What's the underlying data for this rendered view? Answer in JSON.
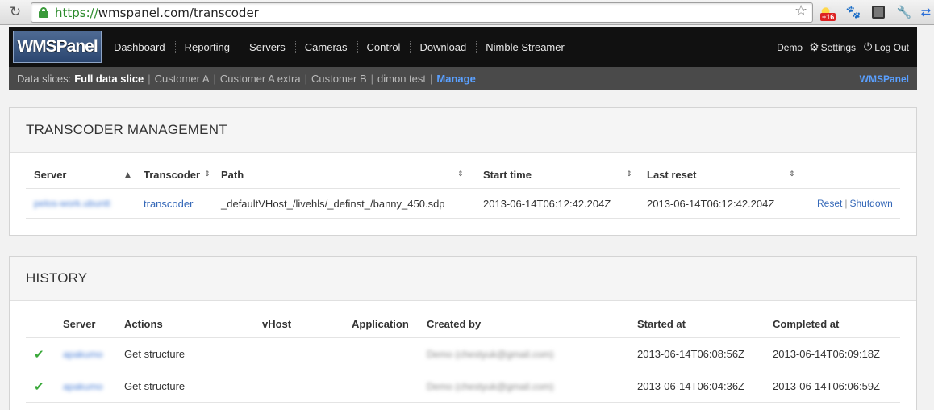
{
  "browser": {
    "url_scheme": "https://",
    "url_rest": "wmspanel.com/transcoder",
    "weather_badge": "+16"
  },
  "header": {
    "logo": "WMSPanel",
    "nav": [
      "Dashboard",
      "Reporting",
      "Servers",
      "Cameras",
      "Control",
      "Download",
      "Nimble Streamer"
    ],
    "user": "Demo",
    "settings": "Settings",
    "logout": "Log Out"
  },
  "slices": {
    "label": "Data slices:",
    "active": "Full data slice",
    "items": [
      "Customer A",
      "Customer A extra",
      "Customer B",
      "dimon test"
    ],
    "manage": "Manage",
    "brand": "WMSPanel"
  },
  "transcoder": {
    "title": "TRANSCODER MANAGEMENT",
    "columns": [
      "Server",
      "Transcoder",
      "Path",
      "Start time",
      "Last reset"
    ],
    "rows": [
      {
        "server": "pelos-work.ubuntt",
        "transcoder": "transcoder",
        "path": "_defaultVHost_/livehls/_definst_/banny_450.sdp",
        "start_time": "2013-06-14T06:12:42.204Z",
        "last_reset": "2013-06-14T06:12:42.204Z",
        "reset": "Reset",
        "shutdown": "Shutdown"
      }
    ]
  },
  "history": {
    "title": "HISTORY",
    "columns": [
      "Server",
      "Actions",
      "vHost",
      "Application",
      "Created by",
      "Started at",
      "Completed at"
    ],
    "rows": [
      {
        "server": "apakumo",
        "action": "Get structure",
        "vhost": "",
        "application": "",
        "created_by": "Demo (chestyuk@gmail.com)",
        "started_at": "2013-06-14T06:08:56Z",
        "completed_at": "2013-06-14T06:09:18Z"
      },
      {
        "server": "apakumo",
        "action": "Get structure",
        "vhost": "",
        "application": "",
        "created_by": "Demo (chestyuk@gmail.com)",
        "started_at": "2013-06-14T06:04:36Z",
        "completed_at": "2013-06-14T06:06:59Z"
      }
    ]
  }
}
